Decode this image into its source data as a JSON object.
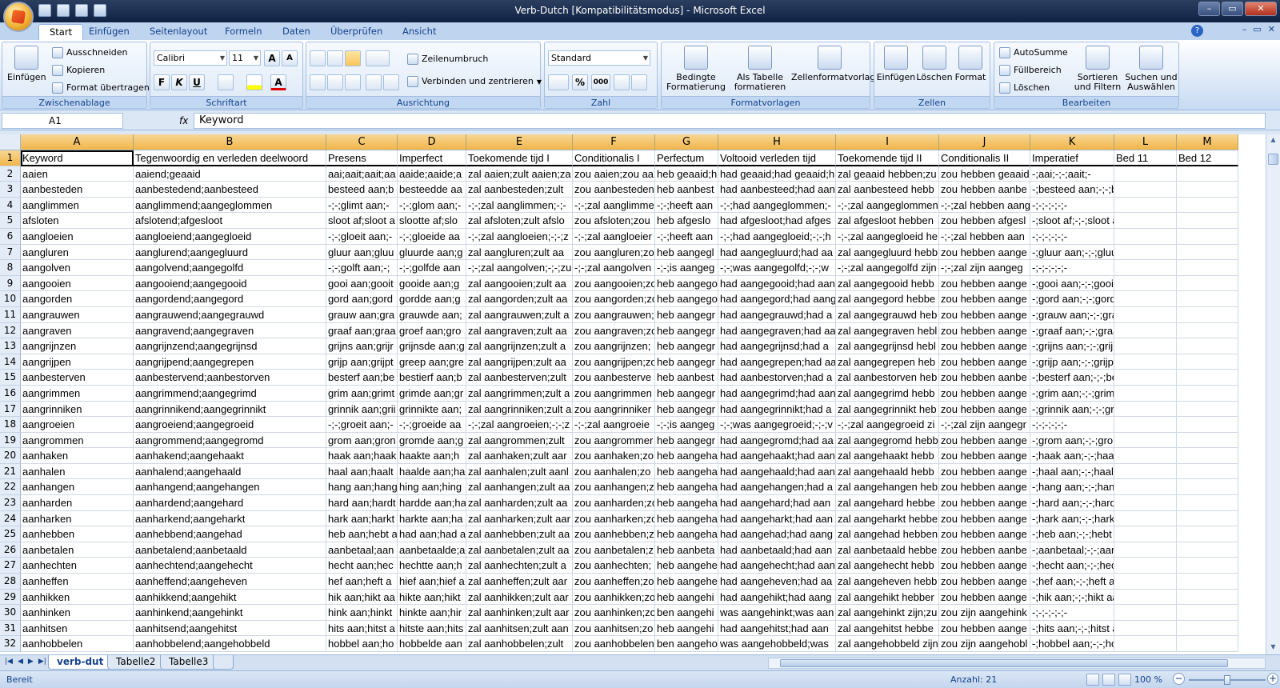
{
  "window": {
    "title": "Verb-Dutch  [Kompatibilitätsmodus] - Microsoft Excel"
  },
  "window_controls": [
    "–",
    "▭",
    "✕"
  ],
  "doc_controls": [
    "–",
    "▭",
    "✕"
  ],
  "help_label": "?",
  "tabs": [
    "Start",
    "Einfügen",
    "Seitenlayout",
    "Formeln",
    "Daten",
    "Überprüfen",
    "Ansicht"
  ],
  "ribbon": {
    "clipboard": {
      "label": "Zwischenablage",
      "paste": "Einfügen",
      "cut": "Ausschneiden",
      "copy": "Kopieren",
      "format_painter": "Format übertragen"
    },
    "font": {
      "label": "Schriftart",
      "name": "Calibri",
      "size": "11",
      "grow": "A",
      "shrink": "A",
      "bold": "F",
      "italic": "K",
      "underline": "U",
      "font_color": "A"
    },
    "alignment": {
      "label": "Ausrichtung",
      "wrap": "Zeilenumbruch",
      "merge": "Verbinden und zentrieren"
    },
    "number": {
      "label": "Zahl",
      "format": "Standard",
      "percent": "%",
      "thousands": "000"
    },
    "styles": {
      "label": "Formatvorlagen",
      "conditional": "Bedingte Formatierung",
      "as_table": "Als Tabelle formatieren",
      "cell_styles": "Zellenformatvorlagen"
    },
    "cells": {
      "label": "Zellen",
      "insert": "Einfügen",
      "delete": "Löschen",
      "format": "Format"
    },
    "editing": {
      "label": "Bearbeiten",
      "autosum": "AutoSumme",
      "fill": "Füllbereich",
      "clear": "Löschen",
      "sort": "Sortieren und Filtern",
      "find": "Suchen und Auswählen"
    }
  },
  "formula_bar": {
    "name_box": "A1",
    "fx": "fx",
    "content": "Keyword"
  },
  "columns": [
    "A",
    "B",
    "C",
    "D",
    "E",
    "F",
    "G",
    "H",
    "I",
    "J",
    "K",
    "L",
    "M"
  ],
  "rows": [
    [
      "1",
      "Keyword",
      "Tegenwoordig en verleden deelwoord",
      "Presens",
      "Imperfect",
      "Toekomende tijd I",
      "Conditionalis I",
      "Perfectum",
      "Voltooid verleden tijd",
      "Toekomende tijd II",
      "Conditionalis II",
      "Imperatief",
      "Bed 11",
      "Bed 12"
    ],
    [
      "2",
      "aaien",
      "aaiend;geaaid",
      "aai;aait;aait;aa",
      "aaide;aaide;a",
      "zal aaien;zult aaien;za",
      "zou aaien;zou aa",
      "heb geaaid;h",
      "had geaaid;had geaaid;h",
      "zal geaaid hebben;zu",
      "zou hebben geaaid",
      "-;aai;-;-;aait;-",
      "",
      ""
    ],
    [
      "3",
      "aanbesteden",
      "aanbestedend;aanbesteed",
      "besteed aan;b",
      "besteedde aa",
      "zal aanbesteden;zult",
      "zou aanbesteden",
      "heb aanbest",
      "had aanbesteed;had aan",
      "zal aanbesteed hebb",
      "zou hebben aanbe",
      "-;besteed aan;-;-;besteedt aan;-",
      "",
      ""
    ],
    [
      "4",
      "aanglimmen",
      "aanglimmend;aangeglommen",
      "-;-;glimt aan;-",
      "-;-;glom aan;-",
      "-;-;zal aanglimmen;-;-",
      "-;-;zal aanglimme",
      "-;-;heeft aan",
      "-;-;had aangeglommen;-",
      "-;-;zal aangeglommen",
      "-;-;zal hebben aang",
      "-;-;-;-;-;-",
      "",
      ""
    ],
    [
      "5",
      "afsloten",
      "afslotend;afgesloot",
      "sloot af;sloot a",
      "slootte af;slo",
      "zal afsloten;zult afslo",
      "zou afsloten;zou",
      "heb afgeslo",
      "had afgesloot;had afges",
      "zal afgesloot hebben",
      "zou hebben afgesl",
      "-;sloot af;-;-;sloot af;-",
      "",
      ""
    ],
    [
      "6",
      "aangloeien",
      "aangloeiend;aangegloeid",
      "-;-;gloeit aan;-",
      "-;-;gloeide aa",
      "-;-;zal aangloeien;-;-;z",
      "-;-;zal aangloeier",
      "-;-;heeft aan",
      "-;-;had aangegloeid;-;-;h",
      "-;-;zal aangegloeid he",
      "-;-;zal hebben aan",
      "-;-;-;-;-;-",
      "",
      ""
    ],
    [
      "7",
      "aangluren",
      "aanglurend;aangegluurd",
      "gluur aan;gluu",
      "gluurde aan;g",
      "zal aangluren;zult aa",
      "zou aangluren;zo",
      "heb aangegl",
      "had aangegluurd;had aa",
      "zal aangegluurd hebb",
      "zou hebben aange",
      "-;gluur aan;-;-;gluurt aan;-",
      "",
      ""
    ],
    [
      "8",
      "aangolven",
      "aangolvend;aangegolfd",
      "-;-;golft aan;-;",
      "-;-;golfde aan",
      "-;-;zal aangolven;-;-;zu",
      "-;-;zal aangolven",
      "-;-;is aangeg",
      "-;-;was aangegolfd;-;-;w",
      "-;-;zal aangegolfd zijn",
      "-;-;zal zijn aangeg",
      "-;-;-;-;-;-",
      "",
      ""
    ],
    [
      "9",
      "aangooien",
      "aangooiend;aangegooid",
      "gooi aan;gooit",
      "gooide aan;g",
      "zal aangooien;zult aa",
      "zou aangooien;zo",
      "heb aangego",
      "had aangegooid;had aan",
      "zal aangegooid hebb",
      "zou hebben aange",
      "-;gooi aan;-;-;gooit aan;-",
      "",
      ""
    ],
    [
      "10",
      "aangorden",
      "aangordend;aangegord",
      "gord aan;gord",
      "gordde aan;g",
      "zal aangorden;zult aa",
      "zou aangorden;zo",
      "heb aangego",
      "had aangegord;had aang",
      "zal aangegord hebbe",
      "zou hebben aange",
      "-;gord aan;-;-;gordt aan;-",
      "",
      ""
    ],
    [
      "11",
      "aangrauwen",
      "aangrauwend;aangegrauwd",
      "grauw aan;gra",
      "grauwde aan;",
      "zal aangrauwen;zult a",
      "zou aangrauwen;",
      "heb aangegr",
      "had aangegrauwd;had a",
      "zal aangegrauwd heb",
      "zou hebben aange",
      "-;grauw aan;-;-;grauwt aan;-",
      "",
      ""
    ],
    [
      "12",
      "aangraven",
      "aangravend;aangegraven",
      "graaf aan;graa",
      "groef aan;gro",
      "zal aangraven;zult aa",
      "zou aangraven;zo",
      "heb aangegr",
      "had aangegraven;had aa",
      "zal aangegraven hebl",
      "zou hebben aange",
      "-;graaf aan;-;-;graaft aan;-",
      "",
      ""
    ],
    [
      "13",
      "aangrijnzen",
      "aangrijnzend;aangegrijnsd",
      "grijns aan;grijr",
      "grijnsde aan;g",
      "zal aangrijnzen;zult a",
      "zou aangrijnzen;",
      "heb aangegr",
      "had aangegrijnsd;had a",
      "zal aangegrijnsd hebl",
      "zou hebben aange",
      "-;grijns aan;-;-;grijnst aan;-",
      "",
      ""
    ],
    [
      "14",
      "aangrijpen",
      "aangrijpend;aangegrepen",
      "grijp aan;grijpt",
      "greep aan;gre",
      "zal aangrijpen;zult aa",
      "zou aangrijpen;zo",
      "heb aangegr",
      "had aangegrepen;had aa",
      "zal aangegrepen heb",
      "zou hebben aange",
      "-;grijp aan;-;-;grijpt aan;-",
      "",
      ""
    ],
    [
      "15",
      "aanbesterven",
      "aanbestervend;aanbestorven",
      "besterf aan;be",
      "bestierf aan;b",
      "zal aanbesterven;zult",
      "zou aanbesterve",
      "heb aanbest",
      "had aanbestorven;had a",
      "zal aanbestorven heb",
      "zou hebben aanbe",
      "-;besterf aan;-;-;besterft aan;-",
      "",
      ""
    ],
    [
      "16",
      "aangrimmen",
      "aangrimmend;aangegrimd",
      "grim aan;grimt",
      "grimde aan;gr",
      "zal aangrimmen;zult a",
      "zou aangrimmen",
      "heb aangegr",
      "had aangegrimd;had aan",
      "zal aangegrimd hebb",
      "zou hebben aange",
      "-;grim aan;-;-;grimt aan;-",
      "",
      ""
    ],
    [
      "17",
      "aangrinniken",
      "aangrinnikend;aangegrinnikt",
      "grinnik aan;grii",
      "grinnikte aan;",
      "zal aangrinniken;zult a",
      "zou aangrinniker",
      "heb aangegr",
      "had aangegrinnikt;had a",
      "zal aangegrinnikt heb",
      "zou hebben aange",
      "-;grinnik aan;-;-;grinnikt aan;-",
      "",
      ""
    ],
    [
      "18",
      "aangroeien",
      "aangroeiend;aangegroeid",
      "-;-;groeit aan;-",
      "-;-;groeide aa",
      "-;-;zal aangroeien;-;-;z",
      "-;-;zal aangroeie",
      "-;-;is aangeg",
      "-;-;was aangegroeid;-;-;v",
      "-;-;zal aangegroeid zi",
      "-;-;zal zijn aangegr",
      "-;-;-;-;-;-",
      "",
      ""
    ],
    [
      "19",
      "aangrommen",
      "aangrommend;aangegromd",
      "grom aan;gron",
      "gromde aan;g",
      "zal aangrommen;zult",
      "zou aangrommer",
      "heb aangegr",
      "had aangegromd;had aa",
      "zal aangegromd hebb",
      "zou hebben aange",
      "-;grom aan;-;-;gromt aan;-",
      "",
      ""
    ],
    [
      "20",
      "aanhaken",
      "aanhakend;aangehaakt",
      "haak aan;haak",
      "haakte aan;h",
      "zal aanhaken;zult aar",
      "zou aanhaken;zo",
      "heb aangeha",
      "had aangehaakt;had aan",
      "zal aangehaakt hebb",
      "zou hebben aange",
      "-;haak aan;-;-;haakt aan;-",
      "",
      ""
    ],
    [
      "21",
      "aanhalen",
      "aanhalend;aangehaald",
      "haal aan;haalt",
      "haalde aan;ha",
      "zal aanhalen;zult aanl",
      "zou aanhalen;zo",
      "heb aangeha",
      "had aangehaald;had aan",
      "zal aangehaald hebb",
      "zou hebben aange",
      "-;haal aan;-;-;haalt aan;-",
      "",
      ""
    ],
    [
      "22",
      "aanhangen",
      "aanhangend;aangehangen",
      "hang aan;hang",
      "hing aan;hing",
      "zal aanhangen;zult aa",
      "zou aanhangen;z",
      "heb aangeha",
      "had aangehangen;had a",
      "zal aangehangen heb",
      "zou hebben aange",
      "-;hang aan;-;-;hangt aan;-",
      "",
      ""
    ],
    [
      "23",
      "aanharden",
      "aanhardend;aangehard",
      "hard aan;hardt",
      "hardde aan;ha",
      "zal aanharden;zult aa",
      "zou aanharden;zo",
      "heb aangeha",
      "had aangehard;had aan",
      "zal aangehard hebbe",
      "zou hebben aange",
      "-;hard aan;-;-;hardt aan;-",
      "",
      ""
    ],
    [
      "24",
      "aanharken",
      "aanharkend;aangeharkt",
      "hark aan;harkt",
      "harkte aan;ha",
      "zal aanharken;zult aar",
      "zou aanharken;zo",
      "heb aangeha",
      "had aangeharkt;had aan",
      "zal aangeharkt hebbe",
      "zou hebben aange",
      "-;hark aan;-;-;harkt aan;-",
      "",
      ""
    ],
    [
      "25",
      "aanhebben",
      "aanhebbend;aangehad",
      "heb aan;hebt a",
      "had aan;had a",
      "zal aanhebben;zult aa",
      "zou aanhebben;z",
      "heb aangeha",
      "had aangehad;had aang",
      "zal aangehad hebben",
      "zou hebben aange",
      "-;heb aan;-;-;hebt aan;-",
      "",
      ""
    ],
    [
      "26",
      "aanbetalen",
      "aanbetalend;aanbetaald",
      "aanbetaal;aan",
      "aanbetaalde;a",
      "zal aanbetalen;zult aa",
      "zou aanbetalen;z",
      "heb aanbeta",
      "had aanbetaald;had aan",
      "zal aanbetaald hebbe",
      "zou hebben aanbe",
      "-;aanbetaal;-;-;aanbetaalt;-",
      "",
      ""
    ],
    [
      "27",
      "aanhechten",
      "aanhechtend;aangehecht",
      "hecht aan;hec",
      "hechtte aan;h",
      "zal aanhechten;zult a",
      "zou aanhechten;",
      "heb aangehe",
      "had aangehecht;had aan",
      "zal aangehecht hebb",
      "zou hebben aange",
      "-;hecht aan;-;-;hecht aan;-",
      "",
      ""
    ],
    [
      "28",
      "aanheffen",
      "aanheffend;aangeheven",
      "hef aan;heft a",
      "hief aan;hief a",
      "zal aanheffen;zult aar",
      "zou aanheffen;zo",
      "heb aangehe",
      "had aangeheven;had aa",
      "zal aangeheven hebb",
      "zou hebben aange",
      "-;hef aan;-;-;heft aan;-",
      "",
      ""
    ],
    [
      "29",
      "aanhikken",
      "aanhikkend;aangehikt",
      "hik aan;hikt aa",
      "hikte aan;hikt",
      "zal aanhikken;zult aar",
      "zou aanhikken;zo",
      "heb aangehi",
      "had aangehikt;had aang",
      "zal aangehikt hebber",
      "zou hebben aange",
      "-;hik aan;-;-;hikt aan;-",
      "",
      ""
    ],
    [
      "30",
      "aanhinken",
      "aanhinkend;aangehinkt",
      "hink aan;hinkt",
      "hinkte aan;hir",
      "zal aanhinken;zult aar",
      "zou aanhinken;zo",
      "ben aangehi",
      "was aangehinkt;was aan",
      "zal aangehinkt zijn;zu",
      "zou zijn aangehink",
      "-;-;-;-;-;-",
      "",
      ""
    ],
    [
      "31",
      "aanhitsen",
      "aanhitsend;aangehitst",
      "hits aan;hitst a",
      "hitste aan;hits",
      "zal aanhitsen;zult aan",
      "zou aanhitsen;zo",
      "heb aangehi",
      "had aangehitst;had aan",
      "zal aangehitst hebbe",
      "zou hebben aange",
      "-;hits aan;-;-;hitst aan;-",
      "",
      ""
    ],
    [
      "32",
      "aanhobbelen",
      "aanhobbelend;aangehobbeld",
      "hobbel aan;ho",
      "hobbelde aan",
      "zal aanhobbelen;zult",
      "zou aanhobbelen",
      "ben aangeho",
      "was aangehobbeld;was",
      "zal aangehobbeld zijn",
      "zou zijn aangehobl",
      "-;hobbel aan;-;-;hobbelt aan;-",
      "",
      ""
    ]
  ],
  "sheets": [
    "verb-dut",
    "Tabelle2",
    "Tabelle3"
  ],
  "status": {
    "ready": "Bereit",
    "count": "Anzahl: 21",
    "zoom": "100 %"
  }
}
